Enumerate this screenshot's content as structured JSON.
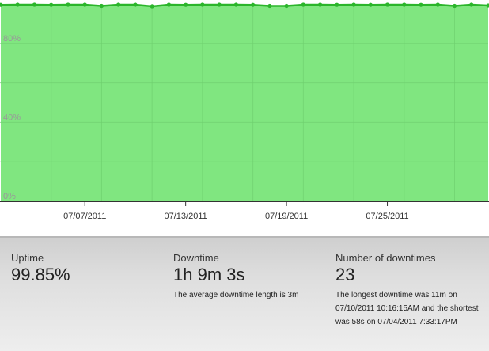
{
  "colors": {
    "fill": "#80e680",
    "line": "#2bb52b",
    "grid": "#6fd06f",
    "axis": "#333333"
  },
  "chart_data": {
    "type": "area",
    "x_start": "07/02/2011",
    "x_end": "07/31/2011",
    "xticks": [
      "07/07/2011",
      "07/13/2011",
      "07/19/2011",
      "07/25/2011"
    ],
    "yticks": [
      "0%",
      "40%",
      "80%"
    ],
    "ylim": [
      0,
      100
    ],
    "grid": true,
    "series": [
      {
        "values": [
          99.5,
          99.6,
          99.6,
          99.5,
          99.6,
          99.6,
          99.0,
          99.6,
          99.6,
          98.8,
          99.6,
          99.5,
          99.6,
          99.6,
          99.6,
          99.5,
          99.0,
          99.0,
          99.6,
          99.6,
          99.5,
          99.6,
          99.5,
          99.6,
          99.6,
          99.5,
          99.6,
          99.0,
          99.6,
          99.2
        ]
      }
    ]
  },
  "stats": {
    "uptime": {
      "label": "Uptime",
      "value": "99.85%"
    },
    "downtime": {
      "label": "Downtime",
      "value": "1h 9m 3s",
      "note": "The average downtime length is 3m"
    },
    "count": {
      "label": "Number of downtimes",
      "value": "23",
      "note": "The longest downtime was 11m on 07/10/2011 10:16:15AM and the shortest was 58s on 07/04/2011 7:33:17PM"
    }
  }
}
